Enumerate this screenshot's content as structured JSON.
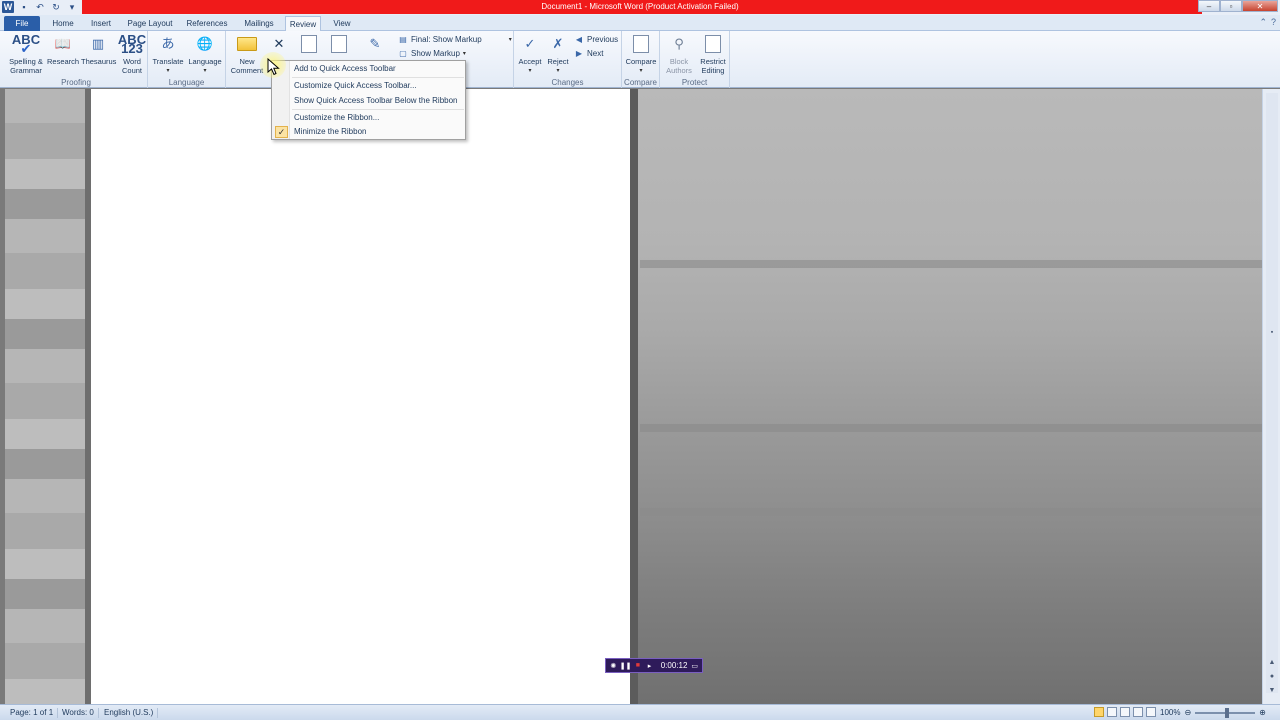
{
  "window": {
    "title": "Document1 - Microsoft Word (Product Activation Failed)"
  },
  "tabs": [
    "File",
    "Home",
    "Insert",
    "Page Layout",
    "References",
    "Mailings",
    "Review",
    "View"
  ],
  "active_tab": "Review",
  "ribbon": {
    "proofing": {
      "label": "Proofing",
      "spelling": "Spelling & Grammar",
      "research": "Research",
      "thesaurus": "Thesaurus",
      "word_count": "Word Count"
    },
    "language": {
      "label": "Language",
      "translate": "Translate",
      "language": "Language"
    },
    "comments": {
      "new_comment": "New Comment"
    },
    "tracking": {
      "final_show_markup": "Final: Show Markup",
      "show_markup": "Show Markup"
    },
    "changes": {
      "label": "Changes",
      "accept": "Accept",
      "reject": "Reject",
      "previous": "Previous",
      "next": "Next"
    },
    "compare": {
      "label": "Compare",
      "compare": "Compare"
    },
    "protect": {
      "label": "Protect",
      "block_authors": "Block Authors",
      "restrict_editing": "Restrict Editing"
    }
  },
  "context_menu": {
    "items": [
      "Add to Quick Access Toolbar",
      "Customize Quick Access Toolbar...",
      "Show Quick Access Toolbar Below the Ribbon",
      "Customize the Ribbon...",
      "Minimize the Ribbon"
    ],
    "checked_item": "Minimize the Ribbon",
    "check_glyph": "✓"
  },
  "statusbar": {
    "page": "Page: 1 of 1",
    "words": "Words: 0",
    "language": "English (U.S.)",
    "zoom": "100%"
  },
  "recorder": {
    "time": "0:00:12"
  }
}
